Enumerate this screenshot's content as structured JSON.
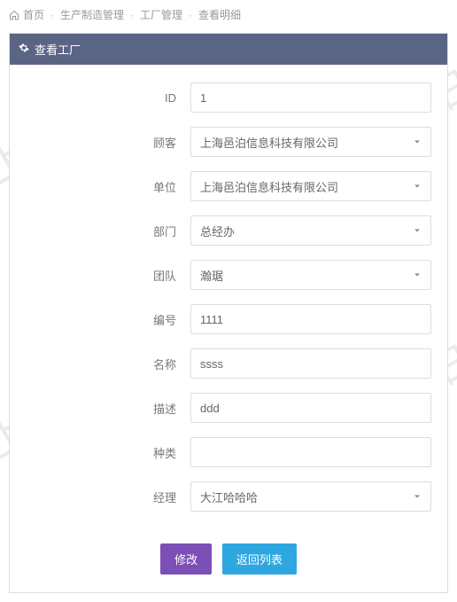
{
  "breadcrumb": {
    "home": "首页",
    "l1": "生产制造管理",
    "l2": "工厂管理",
    "l3": "查看明细"
  },
  "panel": {
    "title": "查看工厂"
  },
  "form": {
    "id_label": "ID",
    "id_value": "1",
    "customer_label": "顾客",
    "customer_value": "上海邑泊信息科技有限公司",
    "unit_label": "单位",
    "unit_value": "上海邑泊信息科技有限公司",
    "dept_label": "部门",
    "dept_value": "总经办",
    "team_label": "团队",
    "team_value": "瀚琚",
    "code_label": "编号",
    "code_value": "1111",
    "name_label": "名称",
    "name_value": "ssss",
    "desc_label": "描述",
    "desc_value": "ddd",
    "kind_label": "种类",
    "kind_value": "",
    "manager_label": "经理",
    "manager_value": "大江哈哈哈"
  },
  "buttons": {
    "edit": "修改",
    "back": "返回列表"
  },
  "watermark_text": "上海邑泊"
}
